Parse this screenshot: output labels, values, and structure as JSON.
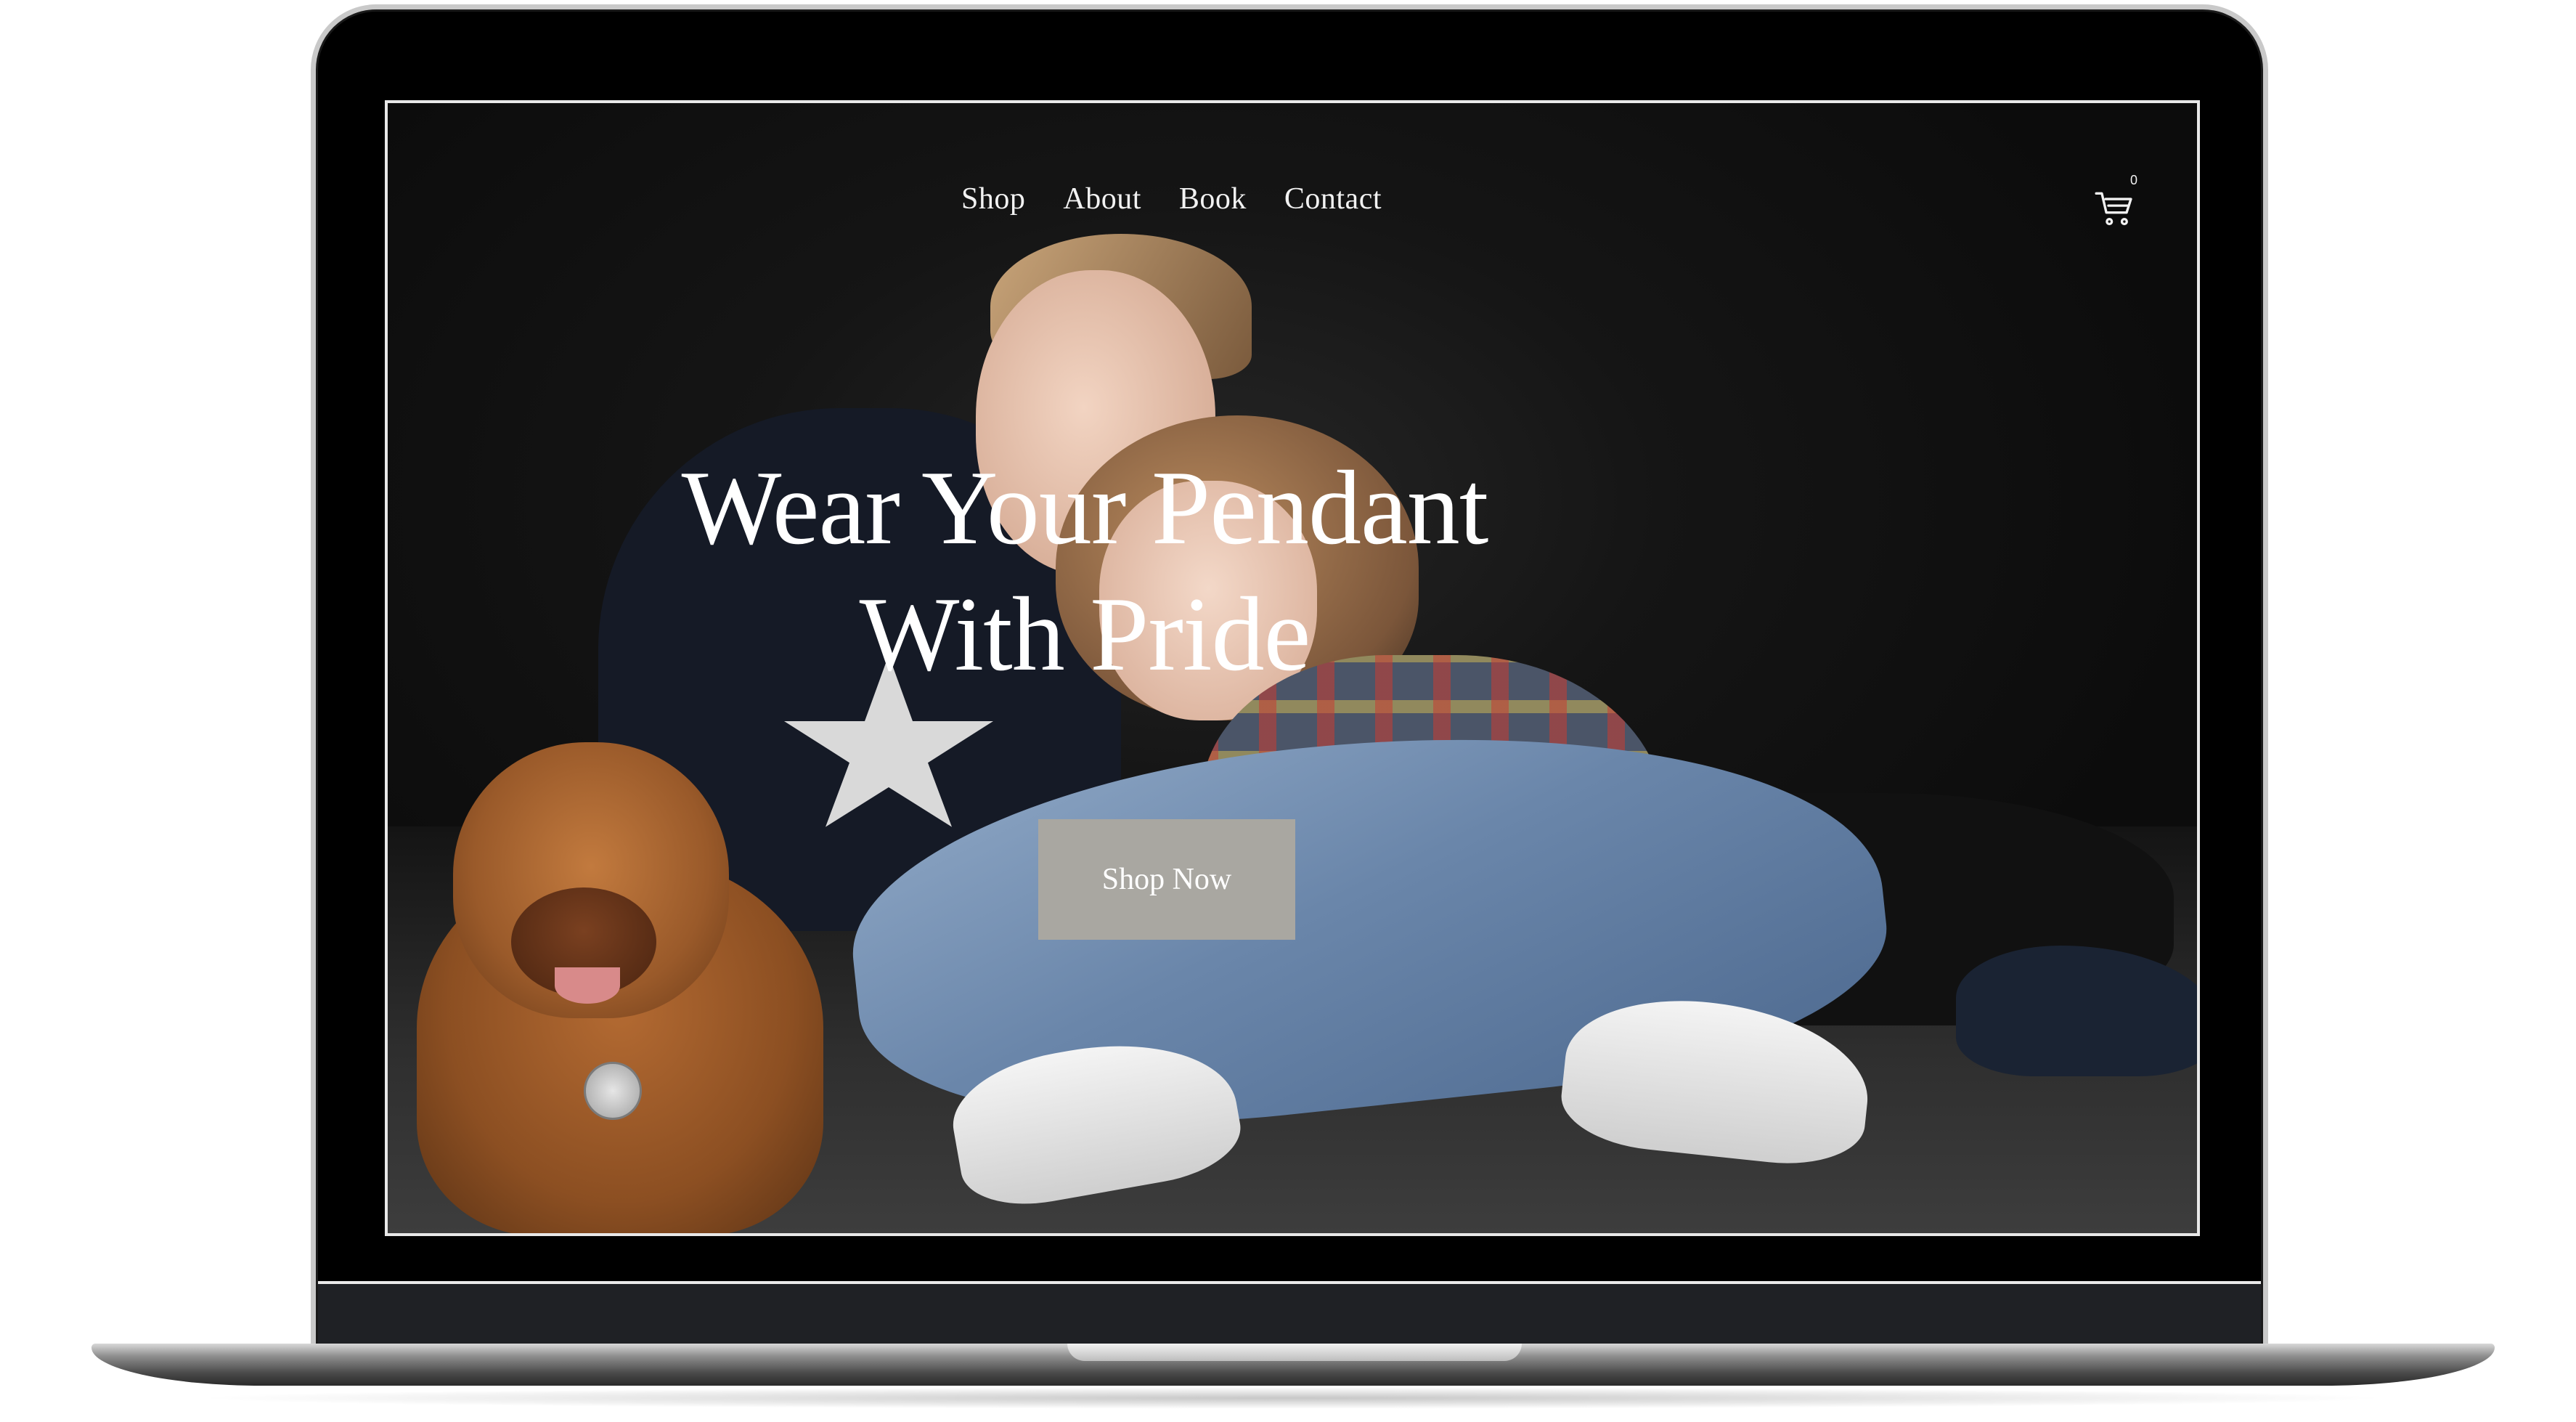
{
  "nav": {
    "items": [
      {
        "label": "Shop"
      },
      {
        "label": "About"
      },
      {
        "label": "Book"
      },
      {
        "label": "Contact"
      }
    ]
  },
  "cart": {
    "icon": "cart-icon",
    "count": "0"
  },
  "hero": {
    "title_line1": "Wear Your Pendant",
    "title_line2": "With Pride",
    "cta_label": "Shop Now"
  },
  "colors": {
    "cta_background": "#a9a7a1",
    "nav_text": "#f2f2f2",
    "screen_background": "#0a0a0a"
  }
}
